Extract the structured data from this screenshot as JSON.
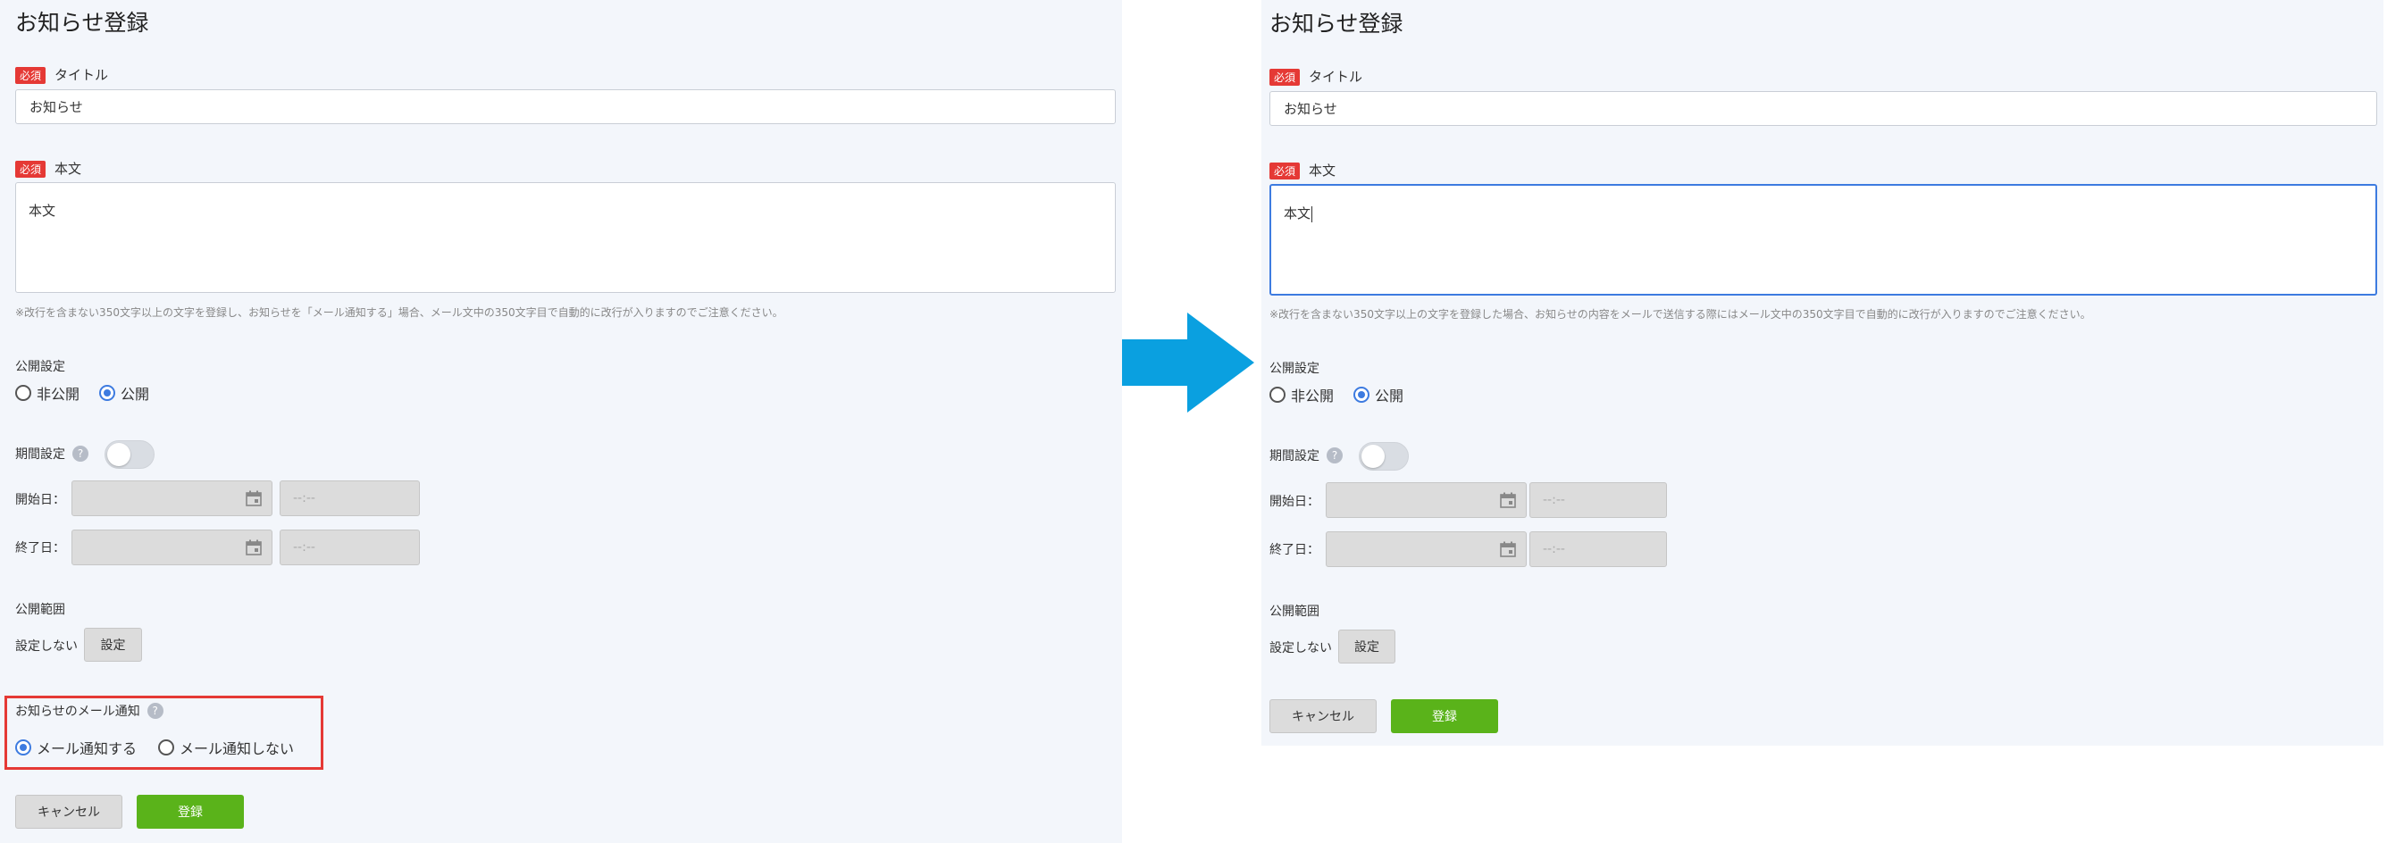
{
  "screen_left": {
    "page_title": "お知らせ登録",
    "required_badge": "必須",
    "title_label": "タイトル",
    "title_value": "お知らせ",
    "body_label": "本文",
    "body_value": "本文",
    "body_note": "※改行を含まない350文字以上の文字を登録し、お知らせを「メール通知する」場合、メール文中の350文字目で自動的に改行が入りますのでご注意ください。",
    "publish_label": "公開設定",
    "publish_options": [
      "非公開",
      "公開"
    ],
    "publish_selected": "公開",
    "period_label": "期間設定",
    "start_label": "開始日：",
    "end_label": "終了日：",
    "time_placeholder": "--:--",
    "scope_label": "公開範囲",
    "scope_value": "設定しない",
    "scope_button": "設定",
    "mail_label": "お知らせのメール通知",
    "mail_options": [
      "メール通知する",
      "メール通知しない"
    ],
    "mail_selected": "メール通知する",
    "cancel_button": "キャンセル",
    "submit_button": "登録"
  },
  "screen_right": {
    "page_title": "お知らせ登録",
    "required_badge": "必須",
    "title_label": "タイトル",
    "title_value": "お知らせ",
    "body_label": "本文",
    "body_value": "本文",
    "body_note": "※改行を含まない350文字以上の文字を登録した場合、お知らせの内容をメールで送信する際にはメール文中の350文字目で自動的に改行が入りますのでご注意ください。",
    "publish_label": "公開設定",
    "publish_options": [
      "非公開",
      "公開"
    ],
    "publish_selected": "公開",
    "period_label": "期間設定",
    "start_label": "開始日：",
    "end_label": "終了日：",
    "time_placeholder": "--:--",
    "scope_label": "公開範囲",
    "scope_value": "設定しない",
    "scope_button": "設定",
    "cancel_button": "キャンセル",
    "submit_button": "登録"
  },
  "colors": {
    "required_badge": "#e53935",
    "highlight": "#e53935",
    "radio_active": "#3d7be0",
    "submit": "#5ab31a",
    "arrow": "#0aa0e0"
  },
  "icons": [
    "help-icon",
    "calendar-icon",
    "arrow-right-icon"
  ]
}
